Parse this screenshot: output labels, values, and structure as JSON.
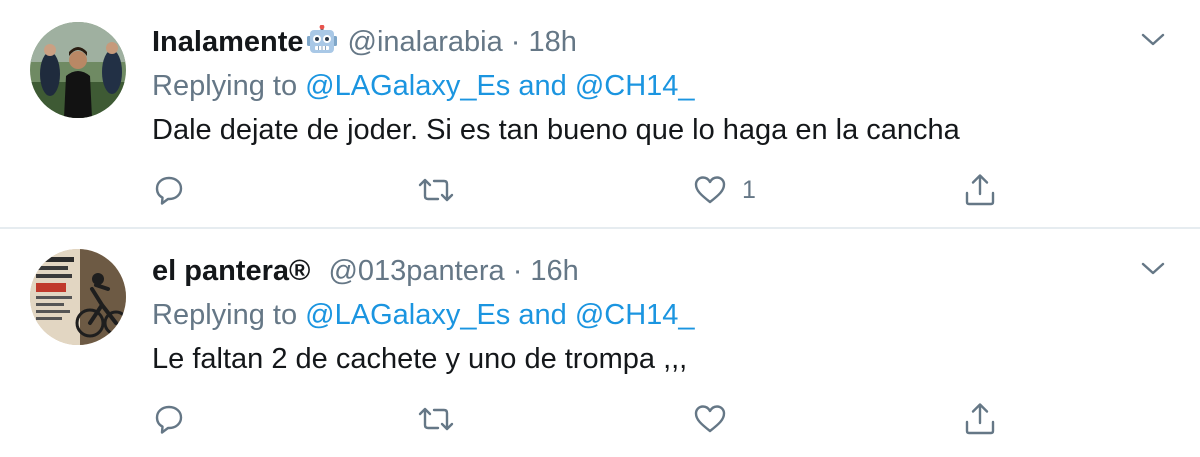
{
  "tweets": [
    {
      "display_name": "Inalamente",
      "handle": "@inalarabia",
      "separator": "·",
      "time": "18h",
      "replying_prefix": "Replying to",
      "replying_to_1": "@LAGalaxy_Es",
      "replying_join": "and",
      "replying_to_2": "@CH14_",
      "text": "Dale dejate de joder. Si es tan bueno que lo haga en la cancha",
      "likes": "1",
      "avatar_icon": "photo-avatar",
      "name_badge_icon": "robot-emoji-icon"
    },
    {
      "display_name": "el pantera®",
      "handle": "@013pantera",
      "separator": "·",
      "time": "16h",
      "replying_prefix": "Replying to",
      "replying_to_1": "@LAGalaxy_Es",
      "replying_join": "and",
      "replying_to_2": "@CH14_",
      "text": "Le faltan 2 de cachete y uno de trompa ,,,",
      "likes": "",
      "avatar_icon": "poster-avatar"
    }
  ],
  "colors": {
    "text": "#14171a",
    "secondary": "#657786",
    "link": "#1b95e0",
    "divider": "#e6ecf0"
  },
  "icons": [
    "reply-icon",
    "retweet-icon",
    "like-icon",
    "share-icon",
    "chevron-down-icon"
  ]
}
